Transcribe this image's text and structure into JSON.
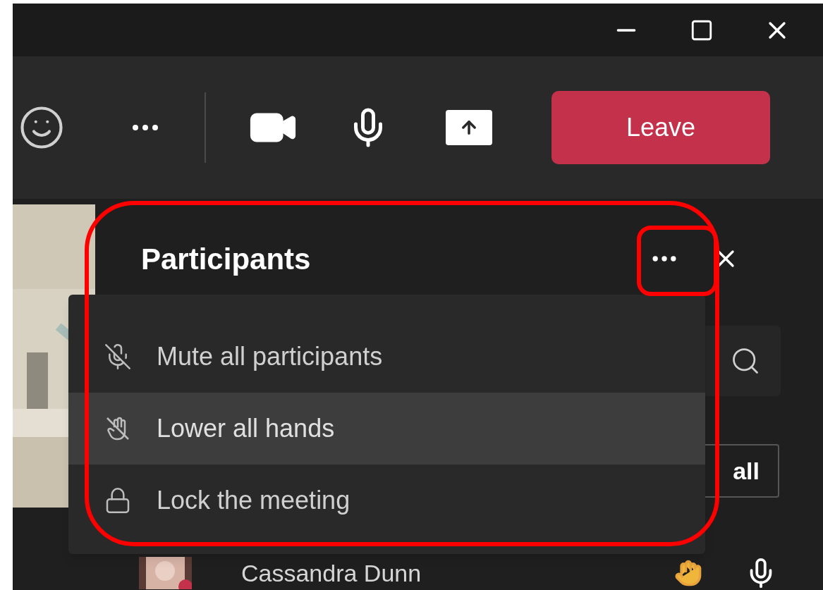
{
  "toolbar": {
    "leave_button": "Leave"
  },
  "participants_panel": {
    "title": "Participants",
    "button_1": "all",
    "participants": [
      {
        "name": "Cassandra Dunn",
        "hand_raised": true
      }
    ]
  },
  "more_menu": {
    "items": [
      {
        "label": "Mute all participants",
        "kind": "mute",
        "selected": false
      },
      {
        "label": "Lower all hands",
        "kind": "lower-hands",
        "selected": true
      },
      {
        "label": "Lock the meeting",
        "kind": "lock",
        "selected": false
      }
    ]
  }
}
